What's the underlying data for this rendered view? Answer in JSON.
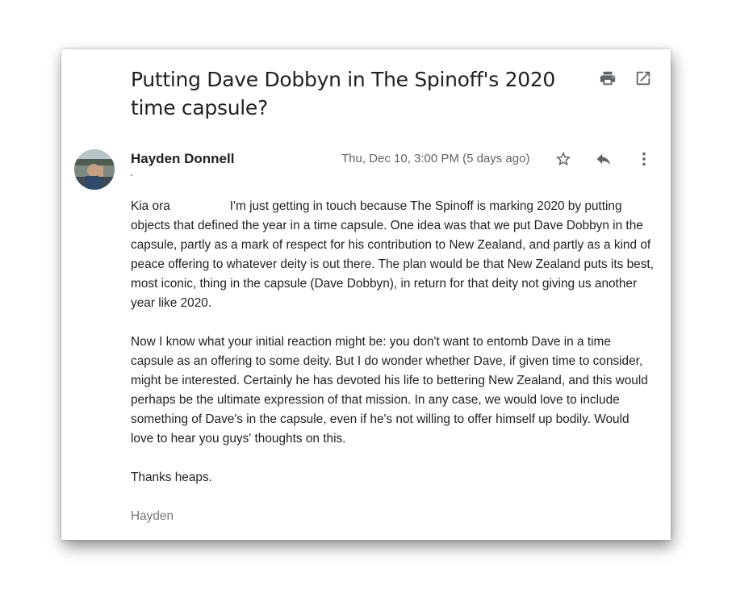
{
  "email": {
    "subject": "Putting Dave Dobbyn in The Spinoff's 2020 time capsule?",
    "sender": "Hayden Donnell",
    "date": "Thu, Dec 10, 3:00 PM (5 days ago)",
    "greeting": "Kia ora",
    "para1": "I'm just getting in touch because The Spinoff is marking 2020 by putting objects that defined the year in a time capsule. One idea was that we put Dave Dobbyn in the capsule, partly as a mark of respect for his contribution to New Zealand, and partly as a kind of peace offering to whatever deity is out there. The plan would be that New Zealand puts its best, most iconic, thing in the capsule (Dave Dobbyn), in return for that deity not giving us another year like 2020.",
    "para2": "Now I know what your initial reaction might be: you don't want to entomb Dave in a time capsule as an offering to some deity. But I do wonder whether Dave, if given time to consider, might be interested. Certainly he has devoted his life to bettering New Zealand, and this would perhaps be the ultimate expression of that mission. In any case, we would love to include something of Dave's in the capsule, even if he's not willing to offer himself up bodily. Would love to hear you guys' thoughts on this.",
    "closing": "Thanks heaps.",
    "signature": "Hayden"
  },
  "icons": {
    "print": "print-icon",
    "open_new": "open-in-new-icon",
    "star": "star-icon",
    "reply": "reply-icon",
    "more": "more-vert-icon"
  },
  "colors": {
    "text": "#222222",
    "muted": "#5f6368",
    "signature": "#777777"
  }
}
